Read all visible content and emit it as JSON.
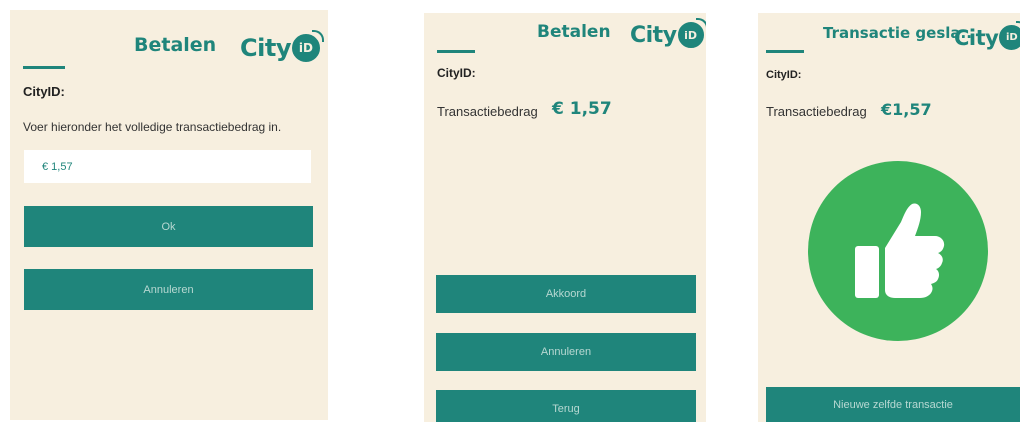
{
  "screens": [
    {
      "title": "Betalen",
      "logo": {
        "text": "City",
        "badge": "iD"
      },
      "cityid_label": "CityID:",
      "instruction": "Voer hieronder het volledige transactiebedrag in.",
      "amount_input_value": "€ 1,57",
      "buttons": {
        "ok": "Ok",
        "cancel": "Annuleren"
      }
    },
    {
      "title": "Betalen",
      "logo": {
        "text": "City",
        "badge": "iD"
      },
      "cityid_label": "CityID:",
      "amount_label": "Transactiebedrag",
      "amount_value": "€ 1,57",
      "buttons": {
        "agree": "Akkoord",
        "cancel": "Annuleren",
        "back": "Terug"
      }
    },
    {
      "title": "Transactie gesla..",
      "logo": {
        "text": "City",
        "badge": "iD"
      },
      "cityid_label": "CityID:",
      "amount_label": "Transactiebedrag",
      "amount_value": "€1,57",
      "success_icon": "thumbs-up-icon",
      "buttons": {
        "new_transaction": "Nieuwe zelfde transactie"
      }
    }
  ],
  "colors": {
    "accent": "#1f857b",
    "background": "#f7efdf",
    "success": "#3db35b"
  }
}
